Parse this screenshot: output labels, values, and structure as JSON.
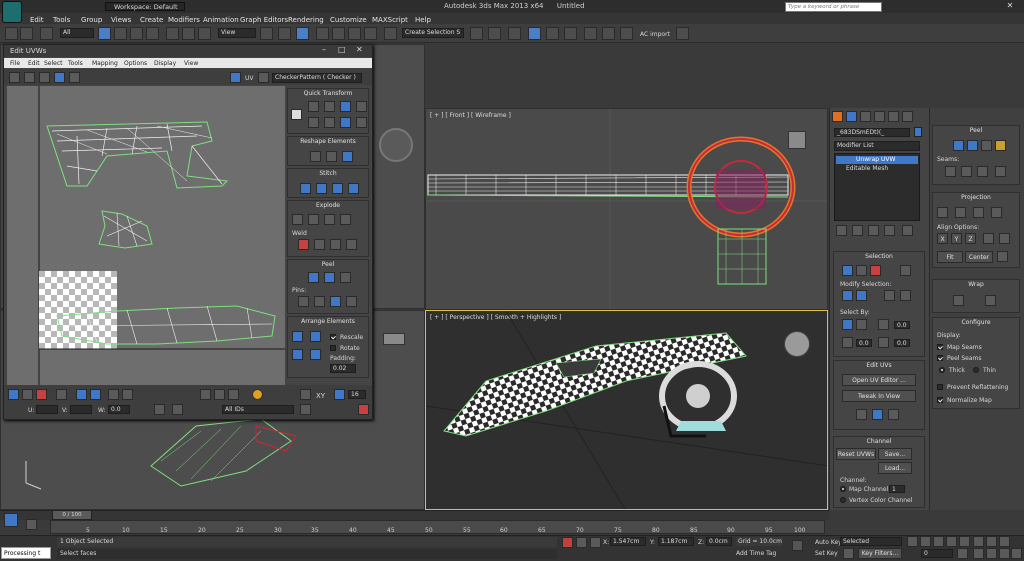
{
  "app": {
    "title": "Autodesk 3ds Max  2013 x64",
    "doc": "Untitled",
    "workspace": "Workspace: Default",
    "search_placeholder": "Type a keyword or phrase"
  },
  "menu": [
    "Edit",
    "Tools",
    "Group",
    "Views",
    "Create",
    "Modifiers",
    "Animation",
    "Graph Editors",
    "Rendering",
    "Customize",
    "MAXScript",
    "Help"
  ],
  "toolbar": {
    "filter": "All",
    "refcoord": "View",
    "selection_set": "Create Selection S",
    "ac_import": "AC import"
  },
  "uv_editor": {
    "title": "Edit UVWs",
    "menu": [
      "File",
      "Edit",
      "Select",
      "Tools",
      "Mapping",
      "Options",
      "Display",
      "View"
    ],
    "uv_label": "UV",
    "checker": "CheckerPattern  ( Checker )",
    "rollouts": {
      "quick_transform": "Quick Transform",
      "reshape": "Reshape Elements",
      "stitch": "Stitch",
      "explode": "Explode",
      "weld": "Weld",
      "peel": "Peel",
      "pins": "Pins:",
      "arrange": "Arrange Elements",
      "rescale": "Rescale",
      "rotate": "Rotate",
      "padding": "Padding:",
      "padding_value": "0.02"
    },
    "bottom": {
      "u_label": "U:",
      "v_label": "V:",
      "w_label": "W:",
      "w_value": "0.0",
      "xy": "XY",
      "zoom": "16",
      "ids": "All IDs"
    }
  },
  "viewports": {
    "front": "[ + ] [ Front ] [ Wireframe ]",
    "perspective": "[ + ] [ Perspective ] [ Smooth + Highlights ]"
  },
  "command_panel": {
    "object_name": "_683DSmEDt)(_",
    "modifier_list": "Modifier List",
    "stack": [
      "Unwrap UVW",
      "Editable Mesh"
    ],
    "selection": {
      "title": "Selection",
      "modify_selection": "Modify Selection:",
      "select_by": "Select By:",
      "v1": "0.0",
      "v2": "0.0",
      "v3": "0.0"
    },
    "edit_uvs": {
      "title": "Edit UVs",
      "open": "Open UV Editor ...",
      "tweak": "Tweak In View"
    },
    "channel": {
      "title": "Channel",
      "reset": "Reset UVWs",
      "save": "Save...",
      "load": "Load...",
      "channel_label": "Channel:",
      "map_channel": "Map Channel:",
      "map_value": "1",
      "vertex_color": "Vertex Color Channel"
    }
  },
  "peel_panel": {
    "peel": "Peel",
    "seams": "Seams:",
    "projection": "Projection",
    "align_options": "Align Options:",
    "align_x": "X",
    "align_y": "Y",
    "align_z": "Z",
    "fit": "Fit",
    "center": "Center",
    "wrap": "Wrap",
    "configure": "Configure",
    "display": "Display:",
    "map_seams": "Map Seams",
    "peel_seams": "Peel Seams",
    "thick": "Thick",
    "thin": "Thin",
    "prevent": "Prevent Reflattening",
    "normalize": "Normalize Map"
  },
  "timeline": {
    "frame": "0 / 100",
    "ticks": [
      "5",
      "10",
      "15",
      "20",
      "25",
      "30",
      "35",
      "40",
      "45",
      "50",
      "55",
      "60",
      "65",
      "70",
      "75",
      "80",
      "85",
      "90",
      "95",
      "100"
    ]
  },
  "status": {
    "selected": "1 Object Selected",
    "prompt": "Select faces",
    "processing": "Processing t",
    "x_label": "X:",
    "x": "1.547cm",
    "y_label": "Y:",
    "y": "1.187cm",
    "z_label": "Z:",
    "z": "0.0cm",
    "grid": "Grid = 10.0cm",
    "add_time_tag": "Add Time Tag",
    "auto_key": "Auto Key",
    "selected_dd": "Selected",
    "set_key": "Set Key",
    "key_filters": "Key Filters...",
    "frame_field": "0"
  },
  "colors": {
    "accent": "#3f78c8",
    "wire_green": "#7fe07f",
    "wire_white": "#f0f0f0",
    "wheel_red": "#c8283c",
    "wheel_orange": "#e07828",
    "selection_yellow": "#e0c040"
  }
}
